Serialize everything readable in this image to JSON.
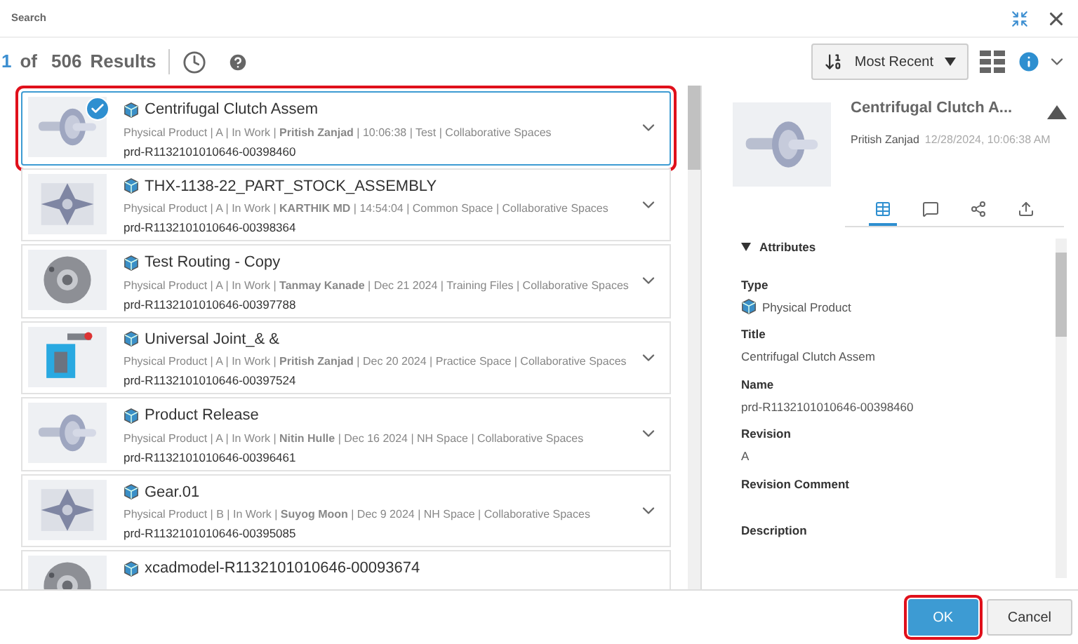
{
  "window": {
    "title": "Search"
  },
  "toolbar": {
    "current": "1",
    "of": "of",
    "total": "506",
    "results": "Results",
    "sort": "Most Recent"
  },
  "results": [
    {
      "title": "Centrifugal Clutch Assem",
      "meta": "Physical Product | A | In Work | **Pritish Zanjad** | 10:06:38 | Test | Collaborative Spaces",
      "name": "prd-R1132101010646-00398460",
      "selected": true,
      "checked": true
    },
    {
      "title": "THX-1138-22_PART_STOCK_ASSEMBLY",
      "meta": "Physical Product | A | In Work | **KARTHIK MD** | 14:54:04 | Common Space | Collaborative Spaces",
      "name": "prd-R1132101010646-00398364",
      "selected": false,
      "checked": false
    },
    {
      "title": "Test Routing - Copy",
      "meta": "Physical Product | A | In Work | **Tanmay Kanade** | Dec 21 2024 | Training Files | Collaborative Spaces",
      "name": "prd-R1132101010646-00397788",
      "selected": false,
      "checked": false
    },
    {
      "title": "Universal Joint_& &",
      "meta": "Physical Product | A | In Work | **Pritish Zanjad** | Dec 20 2024 | Practice Space | Collaborative Spaces",
      "name": "prd-R1132101010646-00397524",
      "selected": false,
      "checked": false
    },
    {
      "title": "Product Release",
      "meta": "Physical Product | A | In Work | **Nitin Hulle** | Dec 16 2024 | NH Space | Collaborative Spaces",
      "name": "prd-R1132101010646-00396461",
      "selected": false,
      "checked": false
    },
    {
      "title": "Gear.01",
      "meta": "Physical Product | B | In Work | **Suyog Moon** | Dec 9 2024 | NH Space | Collaborative Spaces",
      "name": "prd-R1132101010646-00395085",
      "selected": false,
      "checked": false
    },
    {
      "title": "xcadmodel-R1132101010646-00093674",
      "selected": false,
      "checked": false
    }
  ],
  "details": {
    "title": "Centrifugal Clutch A...",
    "owner": "Pritish Zanjad",
    "date": "12/28/2024, 10:06:38 AM",
    "tabs": [
      {
        "selected": true
      },
      {
        "selected": false
      },
      {
        "selected": false
      },
      {
        "selected": false
      }
    ],
    "section": {
      "label": "Attributes",
      "expanded": true
    },
    "fields": [
      {
        "label": "Type",
        "value": "Physical Product",
        "kind": "type"
      },
      {
        "label": "Title",
        "value": "Centrifugal Clutch Assem",
        "kind": "text"
      },
      {
        "label": "Name",
        "value": "prd-R1132101010646-00398460",
        "kind": "text"
      },
      {
        "label": "Revision",
        "value": "A",
        "kind": "text"
      },
      {
        "label": "Revision Comment"
      },
      {
        "label": "Description"
      }
    ]
  },
  "buttons": [
    {
      "label": "OK",
      "kind": "primary"
    },
    {
      "label": "Cancel",
      "kind": "secondary"
    }
  ]
}
